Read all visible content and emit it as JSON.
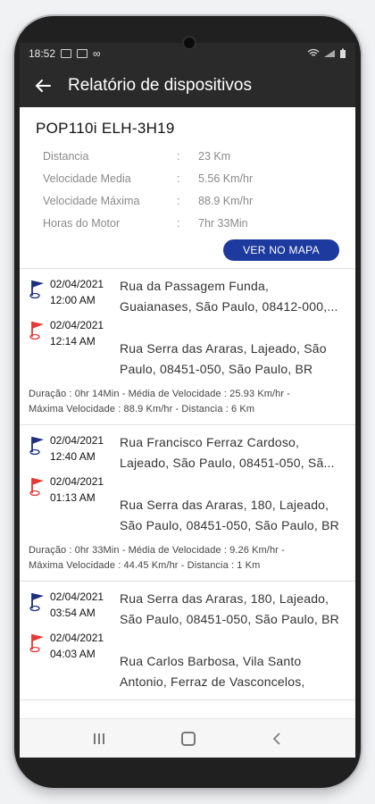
{
  "status": {
    "time": "18:52"
  },
  "appbar": {
    "title": "Relatório de dispositivos"
  },
  "summary": {
    "device": "POP110i ELH-3H19",
    "stats": [
      {
        "label": "Distancia",
        "value": "23 Km"
      },
      {
        "label": "Velocidade Media",
        "value": "5.56 Km/hr"
      },
      {
        "label": "Velocidade Máxima",
        "value": "88.9 Km/hr"
      },
      {
        "label": "Horas do Motor",
        "value": "7hr 33Min"
      }
    ],
    "colon": ":",
    "map_button": "VER NO MAPA"
  },
  "trips": [
    {
      "start": {
        "date": "02/04/2021",
        "time": "12:00 AM",
        "address_l1": "Rua da Passagem Funda,",
        "address_l2": "Guaianases, São Paulo, 08412-000,..."
      },
      "end": {
        "date": "02/04/2021",
        "time": "12:14 AM",
        "address_l1": "Rua Serra das Araras, Lajeado, São",
        "address_l2": "Paulo, 08451-050, São Paulo, BR"
      },
      "meta_l1": "Duração : 0hr 14Min - Média de Velocidade : 25.93 Km/hr -",
      "meta_l2": "Máxima Velocidade : 88.9 Km/hr - Distancia : 6 Km"
    },
    {
      "start": {
        "date": "02/04/2021",
        "time": "12:40 AM",
        "address_l1": "Rua Francisco Ferraz Cardoso,",
        "address_l2": "Lajeado, São Paulo, 08451-050, Sã..."
      },
      "end": {
        "date": "02/04/2021",
        "time": "01:13 AM",
        "address_l1": "Rua Serra das Araras, 180, Lajeado,",
        "address_l2": "São Paulo, 08451-050, São Paulo, BR"
      },
      "meta_l1": "Duração : 0hr 33Min - Média de Velocidade : 9.26 Km/hr -",
      "meta_l2": "Máxima Velocidade : 44.45 Km/hr - Distancia : 1 Km"
    },
    {
      "start": {
        "date": "02/04/2021",
        "time": "03:54 AM",
        "address_l1": "Rua Serra das Araras, 180, Lajeado,",
        "address_l2": "São Paulo, 08451-050, São Paulo, BR"
      },
      "end": {
        "date": "02/04/2021",
        "time": "04:03 AM",
        "address_l1": "Rua Carlos Barbosa, Vila Santo",
        "address_l2": "Antonio, Ferraz de Vasconcelos,"
      },
      "meta_l1": "",
      "meta_l2": ""
    }
  ],
  "icons": {
    "back": "arrow-left-icon",
    "start": "flag-blue-icon",
    "end": "flag-red-icon"
  },
  "colors": {
    "appbar": "#2a2a2a",
    "button": "#1d3a9e",
    "start_flag": "#1c2f80",
    "end_flag": "#e53935"
  }
}
